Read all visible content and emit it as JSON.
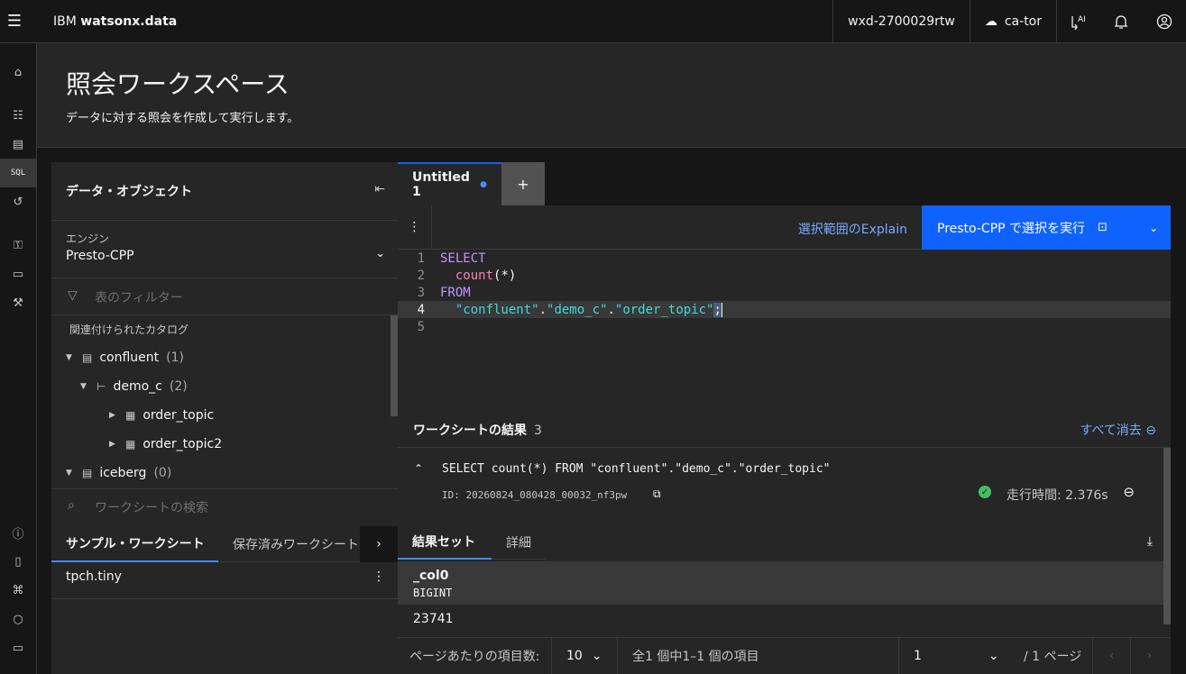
{
  "topbar": {
    "brand_prefix": "IBM",
    "brand_name": "watsonx.data",
    "instance": "wxd-2700029rtw",
    "region": "ca-tor"
  },
  "header": {
    "title": "照会ワークスペース",
    "subtitle": "データに対する照会を作成して実行します。"
  },
  "rail": {
    "sql_label": "SQL"
  },
  "data_objects": {
    "title": "データ・オブジェクト",
    "engine_label": "エンジン",
    "engine_value": "Presto-CPP",
    "filter_placeholder": "表のフィルター",
    "catalogs_label": "関連付けられたカタログ",
    "tree": [
      {
        "name": "confluent",
        "count": "(1)"
      },
      {
        "name": "demo_c",
        "count": "(2)"
      },
      {
        "name": "order_topic",
        "count": ""
      },
      {
        "name": "order_topic2",
        "count": ""
      },
      {
        "name": "iceberg",
        "count": "(0)"
      }
    ]
  },
  "worksheets": {
    "search_placeholder": "ワークシートの検索",
    "tabs": [
      "サンプル・ワークシート",
      "保存済みワークシート"
    ],
    "items": [
      "tpch.tiny"
    ]
  },
  "editor": {
    "tab_title": "Untitled 1",
    "explain_label": "選択範囲のExplain",
    "run_label": "Presto-CPP で選択を実行",
    "lines": [
      "1",
      "2",
      "3",
      "4",
      "5"
    ],
    "code": {
      "l1_kw": "SELECT",
      "l2_fn": "count",
      "l2_rest": "(*)",
      "l3_kw": "FROM",
      "l4_s1": "\"confluent\"",
      "l4_dot1": ".",
      "l4_s2": "\"demo_c\"",
      "l4_dot2": ".",
      "l4_s3": "\"order_topic\"",
      "l4_end": ";"
    }
  },
  "results": {
    "title": "ワークシートの結果",
    "count": "3",
    "clear_all": "すべて消去",
    "query_text": "SELECT count(*) FROM \"confluent\".\"demo_c\".\"order_topic\"",
    "query_id": "ID: 20260824_080428_00032_nf3pw",
    "run_time": "走行時間: 2.376s",
    "tabs": [
      "結果セット",
      "詳細"
    ],
    "column_name": "_col0",
    "column_type": "BIGINT",
    "cell_value": "23741",
    "pager": {
      "per_page_label": "ページあたりの項目数:",
      "per_page": "10",
      "range": "全1 個中1–1 個の項目",
      "page": "1",
      "of_pages": "/ 1 ページ"
    }
  },
  "colors": {
    "accent": "#0f62fe",
    "link": "#78a9ff",
    "success": "#42be65"
  }
}
